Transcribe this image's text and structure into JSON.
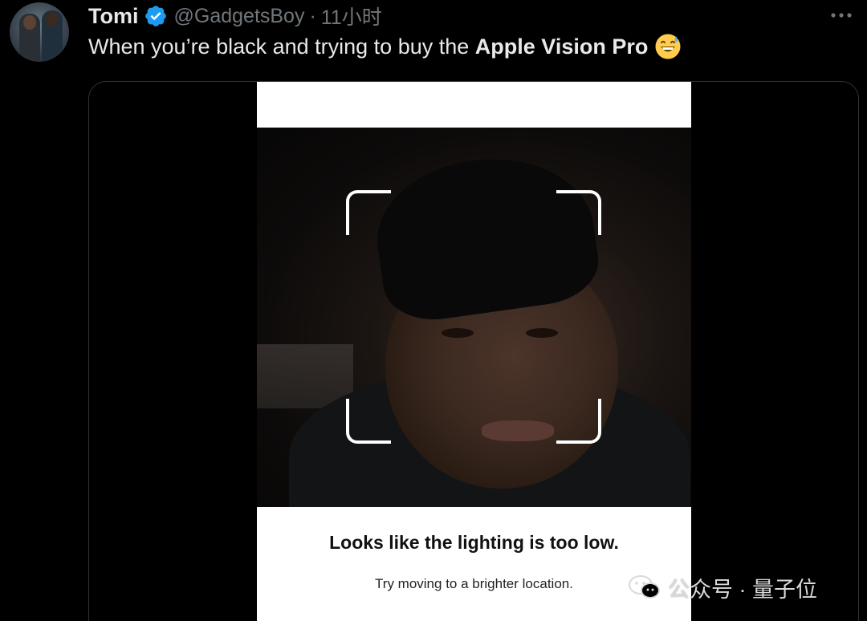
{
  "tweet": {
    "author_name": "Tomi",
    "handle": "@GadgetsBoy",
    "separator": "·",
    "time": "11小时",
    "text_prefix": "When you’re black and trying to buy the",
    "text_bold": "Apple Vision Pro",
    "emoji": "grinning-face-with-sweat"
  },
  "media": {
    "title": "Looks like the lighting is too low.",
    "subtitle": "Try moving to a brighter location."
  },
  "watermark": {
    "text": "公众号 · 量子位"
  },
  "colors": {
    "background": "#000000",
    "text": "#e7e9ea",
    "secondary": "#71767b",
    "verified": "#1d9bf0"
  }
}
